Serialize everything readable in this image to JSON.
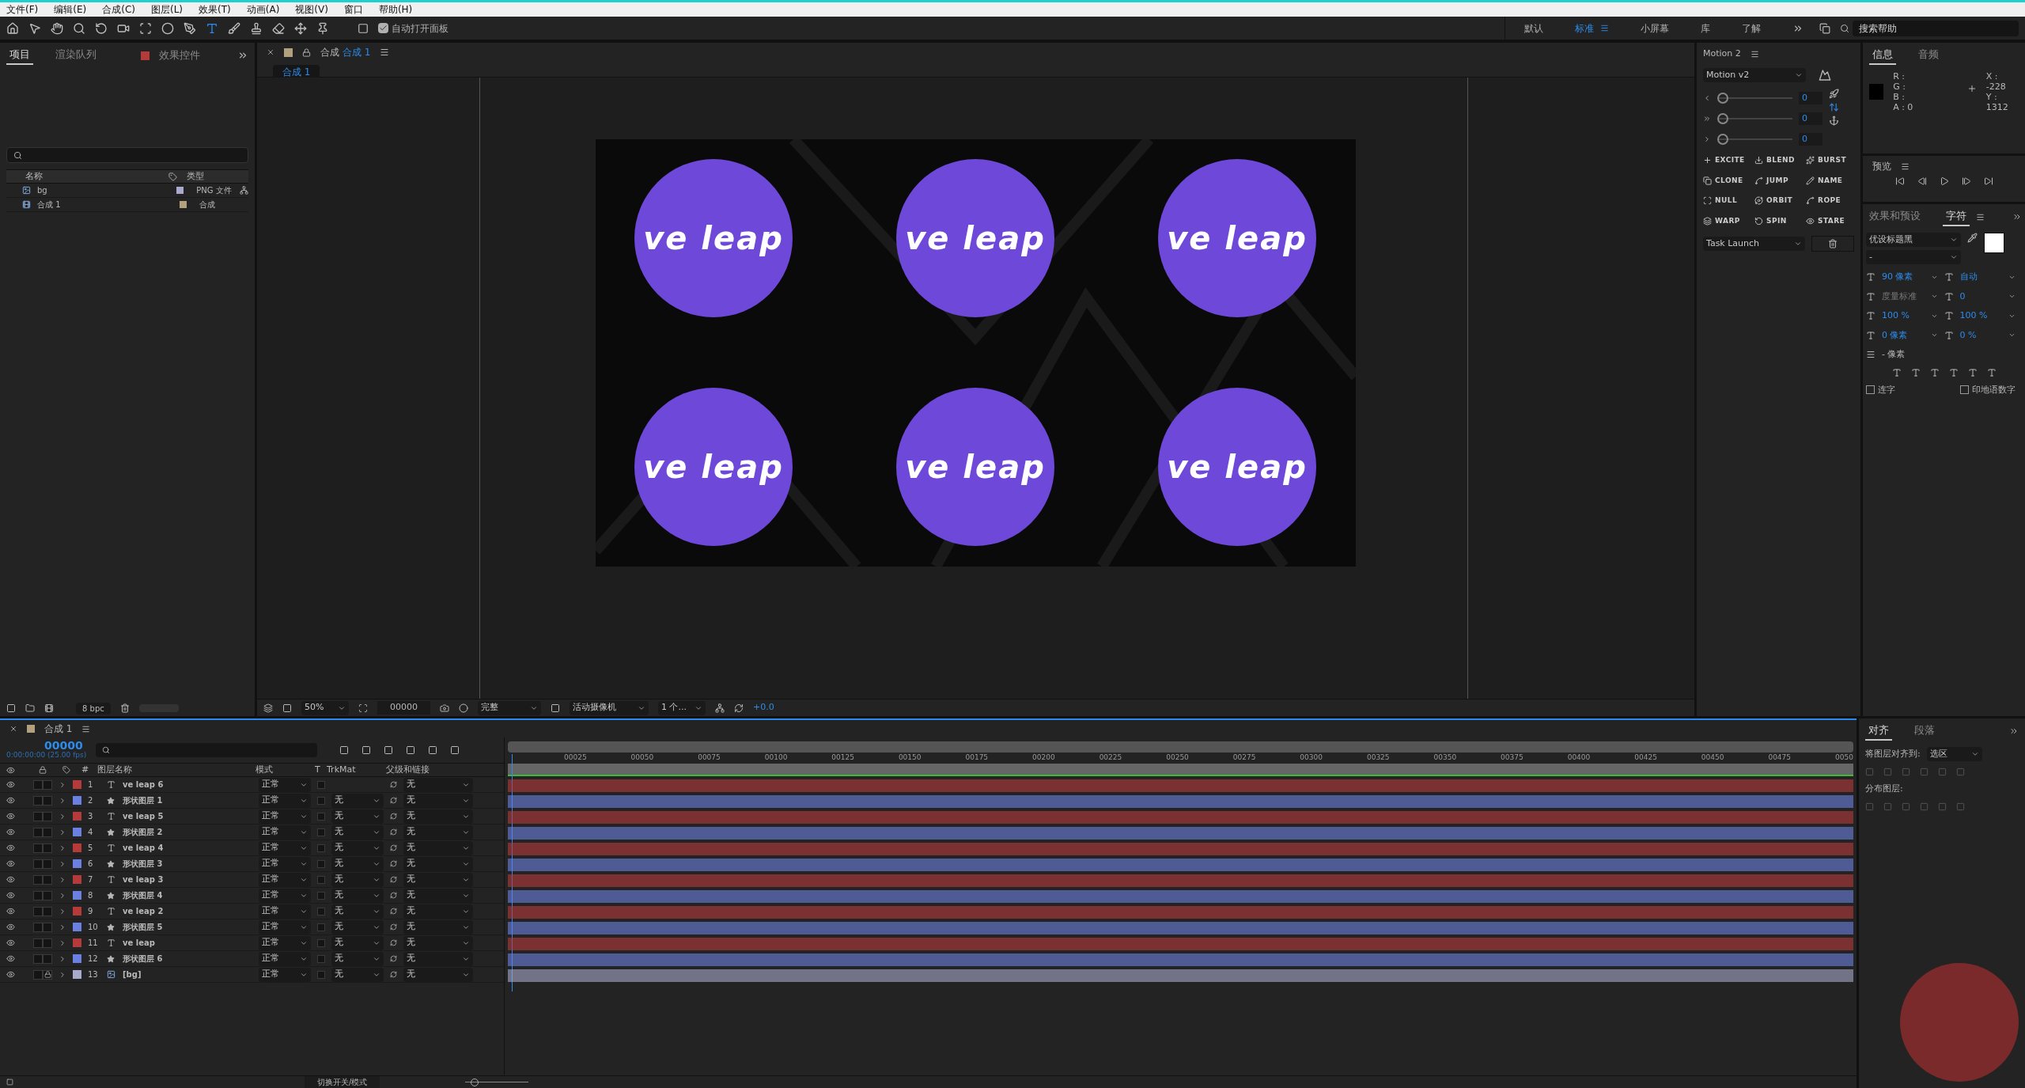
{
  "menu": [
    "文件(F)",
    "编辑(E)",
    "合成(C)",
    "图层(L)",
    "效果(T)",
    "动画(A)",
    "视图(V)",
    "窗口",
    "帮助(H)"
  ],
  "toolbar": {
    "auto_open": {
      "label": "自动打开面板",
      "checked": true
    }
  },
  "workspaces": [
    {
      "label": "默认",
      "selected": false
    },
    {
      "label": "标准",
      "selected": true
    },
    {
      "label": "小屏幕",
      "selected": false
    },
    {
      "label": "库",
      "selected": false
    },
    {
      "label": "了解",
      "selected": false
    }
  ],
  "search_help": {
    "placeholder": "搜索帮助"
  },
  "project": {
    "tabs": [
      {
        "label": "项目",
        "selected": true
      },
      {
        "label": "渲染队列",
        "selected": false
      },
      {
        "label": "效果控件",
        "selected": false
      }
    ],
    "columns": [
      "名称",
      "类型"
    ],
    "items": [
      {
        "name": "bg",
        "type": "PNG 文件",
        "kind": "footage",
        "color": "#a9a9cc"
      },
      {
        "name": "合成 1",
        "type": "合成",
        "kind": "comp",
        "color": "#b2a07e"
      }
    ],
    "bit_depth": "8 bpc"
  },
  "viewer": {
    "tab_prefix": "合成",
    "tab_name": "合成 1",
    "breadcrumb": "合成 1",
    "circles": [
      "ve leap",
      "ve leap",
      "ve leap",
      "ve leap",
      "ve leap",
      "ve leap"
    ],
    "zoom": "50%",
    "timecode": "00000",
    "quality": "完整",
    "camera": "活动摄像机",
    "views": "1 个...",
    "exposure": "+0.0"
  },
  "motion": {
    "title": "Motion 2",
    "preset": "Motion v2",
    "sliders": [
      {
        "value": "0",
        "level": 0
      },
      {
        "value": "0",
        "level": 0
      },
      {
        "value": "0",
        "level": 0
      }
    ],
    "buttons": [
      "EXCITE",
      "BLEND",
      "BURST",
      "CLONE",
      "JUMP",
      "NAME",
      "NULL",
      "ORBIT",
      "ROPE",
      "WARP",
      "SPIN",
      "STARE"
    ],
    "task": "Task Launch"
  },
  "info": {
    "tabs": [
      {
        "label": "信息",
        "selected": true
      },
      {
        "label": "音频",
        "selected": false
      }
    ],
    "rgba": [
      "R :",
      "G :",
      "B :",
      "A :  0"
    ],
    "x": "X : -228",
    "y": "Y : 1312"
  },
  "preview": {
    "title": "预览"
  },
  "character": {
    "tabs": [
      {
        "label": "效果和预设",
        "selected": false
      },
      {
        "label": "字符",
        "selected": true
      }
    ],
    "font": "优设标题黑",
    "style": "-",
    "size": "90 像素",
    "leading": "自动",
    "kerning": "度量标准",
    "tracking": "0",
    "stroke": "- 像素",
    "vscale": "100 %",
    "hscale": "100 %",
    "baseline": "0 像素",
    "tsume": "0 %",
    "checks": [
      {
        "label": "连字",
        "checked": false
      },
      {
        "label": "印地语数字",
        "checked": false
      }
    ]
  },
  "timeline": {
    "tab": "合成 1",
    "timecode": "00000",
    "fps": "0:00:00:00 (25.00 fps)",
    "columns": [
      "#",
      "图层名称",
      "模式",
      "T",
      "TrkMat",
      "父级和链接"
    ],
    "ticks": [
      "00025",
      "00050",
      "00075",
      "00100",
      "00125",
      "00150",
      "00175",
      "00200",
      "00225",
      "00250",
      "00275",
      "00300",
      "00325",
      "00350",
      "00375",
      "00400",
      "00425",
      "00450",
      "00475",
      "0050"
    ],
    "layers": [
      {
        "num": "1",
        "name": "ve leap 6",
        "kind": "text",
        "color": "#b53a3a",
        "mode": "正常",
        "parent": "无",
        "locked": false,
        "visible": true
      },
      {
        "num": "2",
        "name": "形状图层 1",
        "kind": "shape",
        "color": "#6b80e0",
        "mode": "正常",
        "trkmat": "无",
        "parent": "无",
        "locked": false,
        "visible": true
      },
      {
        "num": "3",
        "name": "ve leap 5",
        "kind": "text",
        "color": "#b53a3a",
        "mode": "正常",
        "trkmat": "无",
        "parent": "无",
        "locked": false,
        "visible": true
      },
      {
        "num": "4",
        "name": "形状图层 2",
        "kind": "shape",
        "color": "#6b80e0",
        "mode": "正常",
        "trkmat": "无",
        "parent": "无",
        "locked": false,
        "visible": true
      },
      {
        "num": "5",
        "name": "ve leap 4",
        "kind": "text",
        "color": "#b53a3a",
        "mode": "正常",
        "trkmat": "无",
        "parent": "无",
        "locked": false,
        "visible": true
      },
      {
        "num": "6",
        "name": "形状图层 3",
        "kind": "shape",
        "color": "#6b80e0",
        "mode": "正常",
        "trkmat": "无",
        "parent": "无",
        "locked": false,
        "visible": true
      },
      {
        "num": "7",
        "name": "ve leap 3",
        "kind": "text",
        "color": "#b53a3a",
        "mode": "正常",
        "trkmat": "无",
        "parent": "无",
        "locked": false,
        "visible": true
      },
      {
        "num": "8",
        "name": "形状图层 4",
        "kind": "shape",
        "color": "#6b80e0",
        "mode": "正常",
        "trkmat": "无",
        "parent": "无",
        "locked": false,
        "visible": true
      },
      {
        "num": "9",
        "name": "ve leap 2",
        "kind": "text",
        "color": "#b53a3a",
        "mode": "正常",
        "trkmat": "无",
        "parent": "无",
        "locked": false,
        "visible": true
      },
      {
        "num": "10",
        "name": "形状图层 5",
        "kind": "shape",
        "color": "#6b80e0",
        "mode": "正常",
        "trkmat": "无",
        "parent": "无",
        "locked": false,
        "visible": true
      },
      {
        "num": "11",
        "name": "ve leap",
        "kind": "text",
        "color": "#b53a3a",
        "mode": "正常",
        "trkmat": "无",
        "parent": "无",
        "locked": false,
        "visible": true
      },
      {
        "num": "12",
        "name": "形状图层 6",
        "kind": "shape",
        "color": "#6b80e0",
        "mode": "正常",
        "trkmat": "无",
        "parent": "无",
        "locked": false,
        "visible": true
      },
      {
        "num": "13",
        "name": "[bg]",
        "kind": "footage",
        "color": "#a9a9cc",
        "mode": "正常",
        "trkmat": "无",
        "parent": "无",
        "locked": true,
        "visible": true
      }
    ],
    "switch_label": "切换开关/模式",
    "zoom": {
      "level": 0.1
    }
  },
  "align": {
    "tabs": [
      {
        "label": "对齐",
        "selected": true
      },
      {
        "label": "段落",
        "selected": false
      }
    ],
    "align_to": "将图层对齐到:",
    "target": "选区",
    "distribute": "分布图层:"
  }
}
